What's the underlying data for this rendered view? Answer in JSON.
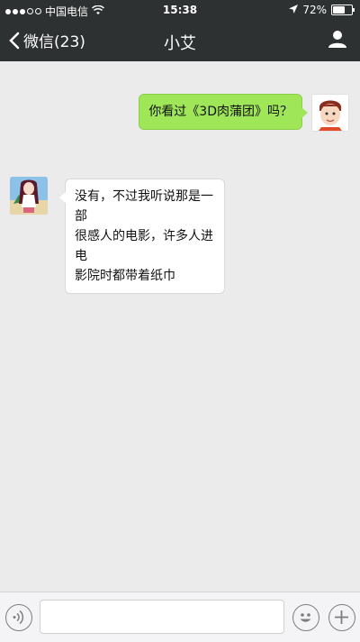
{
  "status_bar": {
    "carrier": "中国电信",
    "time": "15:38",
    "battery_percent": "72%",
    "battery_level": 0.72,
    "signal_icon": "signal-dots-icon",
    "wifi_icon": "wifi-icon",
    "location_icon": "location-arrow-icon"
  },
  "nav": {
    "back_label": "微信(23)",
    "title": "小艾",
    "profile_icon": "person-icon"
  },
  "messages": [
    {
      "sender": "me",
      "text": "你看过《3D肉蒲团》吗？"
    },
    {
      "sender": "friend",
      "lines": [
        "没有，不过我听说那是一部",
        "很感人的电影，许多人进电",
        "影院时都带着纸巾"
      ]
    }
  ],
  "input_bar": {
    "value": "",
    "voice_icon": "voice-icon",
    "emoji_icon": "emoji-icon",
    "plus_icon": "plus-icon"
  },
  "colors": {
    "nav_bg": "#2e3132",
    "sent_bubble": "#9fe658",
    "received_bubble": "#ffffff",
    "chat_bg": "#ebebeb"
  }
}
